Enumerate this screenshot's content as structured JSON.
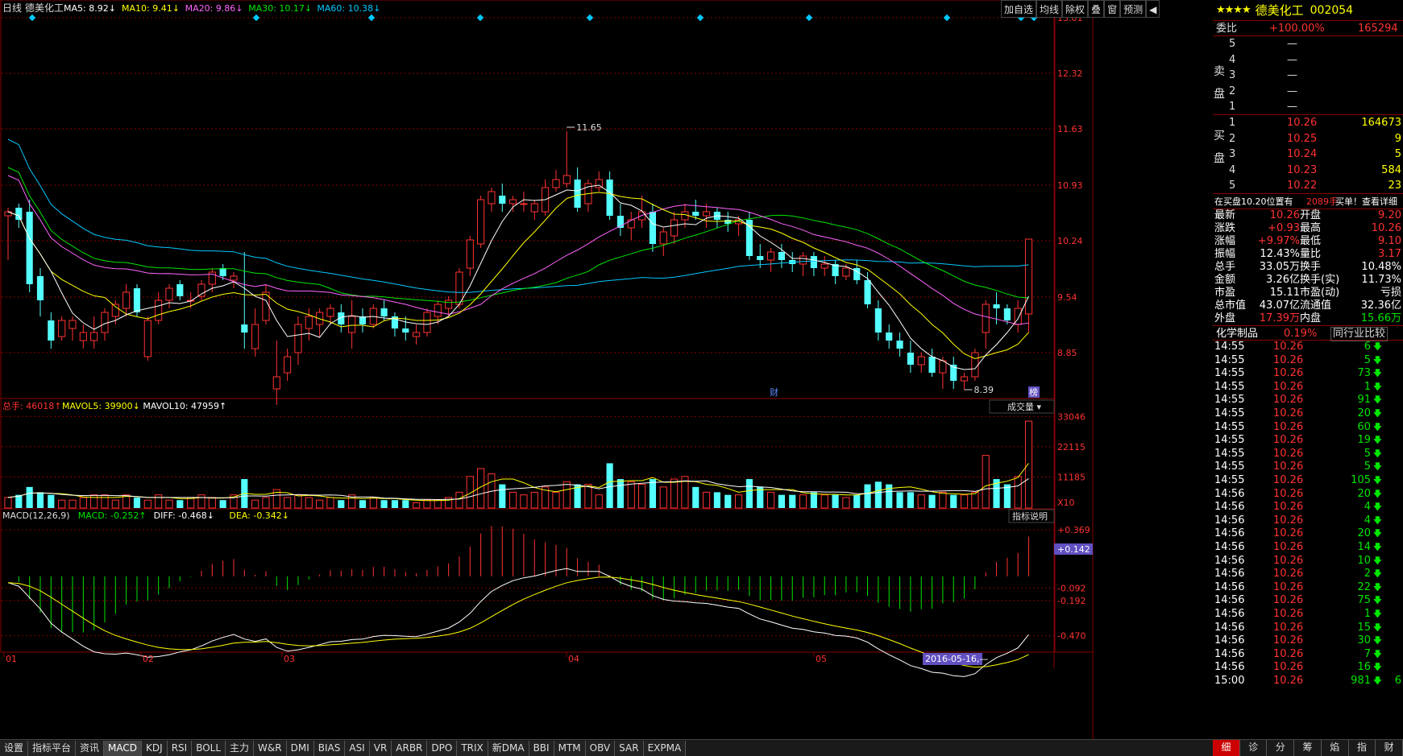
{
  "header": {
    "period": "日线",
    "stock": "德美化工",
    "ma": [
      {
        "label": "MA5: 8.92",
        "arrow": "↓",
        "color": "#ffffff"
      },
      {
        "label": "MA10: 9.41",
        "arrow": "↓",
        "color": "#ffff00"
      },
      {
        "label": "MA20: 9.86",
        "arrow": "↓",
        "color": "#ff64ff"
      },
      {
        "label": "MA30: 10.17",
        "arrow": "↓",
        "color": "#00e600"
      },
      {
        "label": "MA60: 10.38",
        "arrow": "↓",
        "color": "#00c8ff"
      }
    ]
  },
  "toolbar": [
    "加自选",
    "均线",
    "除权",
    "叠",
    "窗",
    "预测"
  ],
  "price_axis": [
    "13.01",
    "12.32",
    "11.63",
    "10.93",
    "10.24",
    "9.54",
    "8.85"
  ],
  "annotations": {
    "high": "11.65",
    "low": "8.39",
    "cai": "财",
    "bang": "榜"
  },
  "vol_header": [
    {
      "label": "总手: 46018",
      "arrow": "↑",
      "color": "#ff3232"
    },
    {
      "label": "MAVOL5: 39900",
      "arrow": "↓",
      "color": "#ffff00"
    },
    {
      "label": "MAVOL10: 47959",
      "arrow": "↑",
      "color": "#ffffff"
    }
  ],
  "vol_selector": "成交量",
  "vol_axis": [
    "33046",
    "22115",
    "11185"
  ],
  "vol_unit": "X10",
  "macd_header": [
    {
      "label": "MACD(12,26,9)",
      "arrow": "",
      "color": "#dddddd"
    },
    {
      "label": "MACD: -0.252",
      "arrow": "↑",
      "color": "#00e600"
    },
    {
      "label": "DIFF: -0.468",
      "arrow": "↓",
      "color": "#ffffff"
    },
    {
      "label": "DEA: -0.342",
      "arrow": "↓",
      "color": "#ffff00"
    }
  ],
  "macd_btn": "指标说明",
  "macd_axis": [
    "0.369",
    "-0.092",
    "-0.192",
    "-0.470"
  ],
  "macd_cursor": "+0.142",
  "date_axis": [
    "01",
    "02",
    "03",
    "04",
    "05"
  ],
  "date_cursor": "2016-05-16,—",
  "bottom_tabs": [
    "设置",
    "指标平台",
    "资讯",
    "MACD",
    "KDJ",
    "RSI",
    "BOLL",
    "主力",
    "W&R",
    "DMI",
    "BIAS",
    "ASI",
    "VR",
    "ARBR",
    "DPO",
    "TRIX",
    "新DMA",
    "BBI",
    "MTM",
    "OBV",
    "SAR",
    "EXPMA"
  ],
  "active_tab": "MACD",
  "quote": {
    "stars": "★★★★",
    "name": "德美化工",
    "code": "002054",
    "weibi_label": "委比",
    "weibi_value": "+100.00%",
    "weibi_diff": "165294",
    "sell_label": [
      "卖",
      "盘"
    ],
    "buy_label": [
      "买",
      "盘"
    ],
    "sells": [
      {
        "n": "5",
        "p": "—",
        "v": ""
      },
      {
        "n": "4",
        "p": "—",
        "v": ""
      },
      {
        "n": "3",
        "p": "—",
        "v": ""
      },
      {
        "n": "2",
        "p": "—",
        "v": ""
      },
      {
        "n": "1",
        "p": "—",
        "v": ""
      }
    ],
    "buys": [
      {
        "n": "1",
        "p": "10.26",
        "v": "164673"
      },
      {
        "n": "2",
        "p": "10.25",
        "v": "9"
      },
      {
        "n": "3",
        "p": "10.24",
        "v": "5"
      },
      {
        "n": "4",
        "p": "10.23",
        "v": "584"
      },
      {
        "n": "5",
        "p": "10.22",
        "v": "23"
      }
    ],
    "notice": {
      "a": "在买盘10.20位置有",
      "b": "2089手",
      "c": "买单！查看详细"
    },
    "stats": [
      [
        "最新",
        "10.26",
        "red",
        "开盘",
        "9.20",
        "red"
      ],
      [
        "涨跌",
        "+0.93",
        "red",
        "最高",
        "10.26",
        "red"
      ],
      [
        "涨幅",
        "+9.97%",
        "red",
        "最低",
        "9.10",
        "red"
      ],
      [
        "振幅",
        "12.43%",
        "white",
        "量比",
        "3.17",
        "red"
      ],
      [
        "总手",
        "33.05万",
        "white",
        "换手",
        "10.48%",
        "white"
      ],
      [
        "金额",
        "3.26亿",
        "white",
        "换手(实)",
        "11.73%",
        "white"
      ],
      [
        "市盈",
        "15.11",
        "white",
        "市盈(动)",
        "亏损",
        "white"
      ],
      [
        "总市值",
        "43.07亿",
        "white",
        "流通值",
        "32.36亿",
        "white"
      ],
      [
        "外盘",
        "17.39万",
        "red",
        "内盘",
        "15.66万",
        "green"
      ]
    ],
    "sector": "化学制品",
    "sector_pct": "0.19%",
    "sector_btn": "同行业比较",
    "ticks": [
      [
        "14:55",
        "10.26",
        "6"
      ],
      [
        "14:55",
        "10.26",
        "5"
      ],
      [
        "14:55",
        "10.26",
        "73"
      ],
      [
        "14:55",
        "10.26",
        "1"
      ],
      [
        "14:55",
        "10.26",
        "91"
      ],
      [
        "14:55",
        "10.26",
        "20"
      ],
      [
        "14:55",
        "10.26",
        "60"
      ],
      [
        "14:55",
        "10.26",
        "19"
      ],
      [
        "14:55",
        "10.26",
        "5"
      ],
      [
        "14:55",
        "10.26",
        "5"
      ],
      [
        "14:55",
        "10.26",
        "105"
      ],
      [
        "14:56",
        "10.26",
        "20"
      ],
      [
        "14:56",
        "10.26",
        "4"
      ],
      [
        "14:56",
        "10.26",
        "4"
      ],
      [
        "14:56",
        "10.26",
        "20"
      ],
      [
        "14:56",
        "10.26",
        "14"
      ],
      [
        "14:56",
        "10.26",
        "10"
      ],
      [
        "14:56",
        "10.26",
        "2"
      ],
      [
        "14:56",
        "10.26",
        "22"
      ],
      [
        "14:56",
        "10.26",
        "75"
      ],
      [
        "14:56",
        "10.26",
        "1"
      ],
      [
        "14:56",
        "10.26",
        "15"
      ],
      [
        "14:56",
        "10.26",
        "30"
      ],
      [
        "14:56",
        "10.26",
        "7"
      ],
      [
        "14:56",
        "10.26",
        "16"
      ],
      [
        "15:00",
        "10.26",
        "981"
      ]
    ],
    "tick_tail": "6",
    "tabs": [
      "细",
      "诊",
      "分",
      "筹",
      "焰",
      "指",
      "财"
    ],
    "active": "细"
  },
  "chart_data": {
    "type": "candlestick",
    "price_range": [
      8.39,
      13.01
    ],
    "candles": [
      [
        10.55,
        10.65,
        10.0,
        10.6,
        4
      ],
      [
        10.65,
        10.7,
        10.4,
        10.5,
        5
      ],
      [
        10.6,
        10.75,
        9.6,
        9.7,
        8
      ],
      [
        9.8,
        9.9,
        9.3,
        9.5,
        6
      ],
      [
        9.25,
        9.35,
        8.9,
        9.0,
        5
      ],
      [
        9.05,
        9.3,
        9.0,
        9.25,
        3
      ],
      [
        9.15,
        9.3,
        9.0,
        9.25,
        3
      ],
      [
        9.0,
        9.2,
        8.9,
        9.1,
        4
      ],
      [
        9.0,
        9.3,
        8.9,
        9.1,
        5
      ],
      [
        9.1,
        9.4,
        9.0,
        9.35,
        5
      ],
      [
        9.3,
        9.5,
        9.2,
        9.45,
        3
      ],
      [
        9.4,
        9.7,
        9.3,
        9.6,
        5
      ],
      [
        9.65,
        9.7,
        9.3,
        9.35,
        4
      ],
      [
        8.8,
        9.3,
        8.75,
        9.25,
        3
      ],
      [
        9.25,
        9.6,
        9.2,
        9.5,
        5
      ],
      [
        9.5,
        9.7,
        9.4,
        9.65,
        3
      ],
      [
        9.7,
        9.75,
        9.5,
        9.55,
        3
      ],
      [
        9.5,
        9.6,
        9.4,
        9.5,
        4
      ],
      [
        9.55,
        9.75,
        9.5,
        9.7,
        5
      ],
      [
        9.7,
        9.9,
        9.6,
        9.85,
        4
      ],
      [
        9.9,
        9.95,
        9.75,
        9.8,
        3
      ],
      [
        9.75,
        9.85,
        9.65,
        9.8,
        5
      ],
      [
        9.2,
        10.1,
        8.9,
        9.1,
        11
      ],
      [
        8.9,
        9.4,
        8.8,
        9.2,
        3
      ],
      [
        9.25,
        9.7,
        9.2,
        9.6,
        4
      ],
      [
        8.4,
        9.0,
        8.2,
        8.55,
        7
      ],
      [
        8.6,
        8.9,
        8.5,
        8.8,
        4
      ],
      [
        8.85,
        9.3,
        8.7,
        9.2,
        5
      ],
      [
        9.15,
        9.4,
        9.0,
        9.3,
        4
      ],
      [
        9.2,
        9.4,
        9.05,
        9.35,
        3
      ],
      [
        9.3,
        9.45,
        9.2,
        9.4,
        4
      ],
      [
        9.35,
        9.45,
        9.1,
        9.2,
        3
      ],
      [
        9.1,
        9.5,
        8.9,
        9.3,
        5
      ],
      [
        9.3,
        9.4,
        9.1,
        9.2,
        3
      ],
      [
        9.2,
        9.45,
        9.15,
        9.4,
        4
      ],
      [
        9.4,
        9.5,
        9.25,
        9.3,
        3
      ],
      [
        9.3,
        9.35,
        9.05,
        9.15,
        3
      ],
      [
        9.15,
        9.3,
        9.0,
        9.1,
        3
      ],
      [
        9.05,
        9.2,
        8.95,
        9.1,
        2
      ],
      [
        9.1,
        9.4,
        9.05,
        9.35,
        3
      ],
      [
        9.3,
        9.5,
        9.2,
        9.45,
        3
      ],
      [
        9.4,
        9.55,
        9.3,
        9.5,
        4
      ],
      [
        9.45,
        9.9,
        9.4,
        9.85,
        6
      ],
      [
        9.9,
        10.3,
        9.8,
        10.25,
        12
      ],
      [
        10.2,
        10.8,
        10.15,
        10.75,
        15
      ],
      [
        10.7,
        10.9,
        10.6,
        10.85,
        13
      ],
      [
        10.8,
        10.95,
        10.6,
        10.7,
        9
      ],
      [
        10.7,
        10.8,
        10.6,
        10.75,
        6
      ],
      [
        10.7,
        10.85,
        10.6,
        10.7,
        5
      ],
      [
        10.6,
        10.75,
        10.5,
        10.7,
        6
      ],
      [
        10.6,
        11.0,
        10.55,
        10.9,
        8
      ],
      [
        10.9,
        11.12,
        10.85,
        11.0,
        6
      ],
      [
        10.95,
        11.6,
        10.9,
        11.05,
        10
      ],
      [
        11.0,
        11.15,
        10.6,
        10.65,
        9
      ],
      [
        10.7,
        11.0,
        10.6,
        10.95,
        9
      ],
      [
        10.9,
        11.1,
        10.85,
        11.0,
        5
      ],
      [
        11.0,
        11.1,
        10.5,
        10.55,
        17
      ],
      [
        10.55,
        10.7,
        10.3,
        10.4,
        11
      ],
      [
        10.4,
        10.6,
        10.25,
        10.5,
        10
      ],
      [
        10.5,
        10.8,
        10.4,
        10.6,
        9
      ],
      [
        10.6,
        10.7,
        10.1,
        10.2,
        11
      ],
      [
        10.2,
        10.4,
        10.05,
        10.35,
        8
      ],
      [
        10.3,
        10.6,
        10.2,
        10.5,
        11
      ],
      [
        10.5,
        10.7,
        10.4,
        10.6,
        12
      ],
      [
        10.6,
        10.75,
        10.5,
        10.55,
        8
      ],
      [
        10.55,
        10.7,
        10.4,
        10.6,
        6
      ],
      [
        10.6,
        10.65,
        10.4,
        10.5,
        6
      ],
      [
        10.5,
        10.6,
        10.35,
        10.45,
        5
      ],
      [
        10.45,
        10.55,
        10.3,
        10.5,
        5
      ],
      [
        10.5,
        10.6,
        10.0,
        10.05,
        11
      ],
      [
        10.05,
        10.2,
        9.9,
        10.0,
        8
      ],
      [
        10.0,
        10.15,
        9.85,
        10.1,
        6
      ],
      [
        10.1,
        10.2,
        9.9,
        10.0,
        5
      ],
      [
        10.0,
        10.1,
        9.85,
        9.95,
        5
      ],
      [
        9.95,
        10.1,
        9.8,
        10.05,
        5
      ],
      [
        10.05,
        10.1,
        9.8,
        9.9,
        6
      ],
      [
        9.9,
        10.05,
        9.8,
        9.95,
        5
      ],
      [
        9.95,
        10.0,
        9.7,
        9.8,
        5
      ],
      [
        9.8,
        9.95,
        9.75,
        9.9,
        4
      ],
      [
        9.9,
        10.0,
        9.7,
        9.75,
        5
      ],
      [
        9.75,
        9.85,
        9.4,
        9.45,
        9
      ],
      [
        9.4,
        9.5,
        9.0,
        9.1,
        10
      ],
      [
        9.1,
        9.2,
        8.9,
        9.0,
        9
      ],
      [
        9.0,
        9.1,
        8.8,
        8.9,
        6
      ],
      [
        8.85,
        9.0,
        8.6,
        8.7,
        6
      ],
      [
        8.7,
        8.85,
        8.6,
        8.8,
        5
      ],
      [
        8.8,
        8.9,
        8.55,
        8.6,
        5
      ],
      [
        8.6,
        8.8,
        8.4,
        8.75,
        6
      ],
      [
        8.7,
        8.8,
        8.4,
        8.5,
        5
      ],
      [
        8.5,
        8.6,
        8.39,
        8.55,
        5
      ],
      [
        8.55,
        8.9,
        8.5,
        8.85,
        6
      ],
      [
        9.1,
        9.5,
        8.9,
        9.45,
        20
      ],
      [
        9.45,
        9.6,
        9.2,
        9.4,
        11
      ],
      [
        9.4,
        9.45,
        9.2,
        9.25,
        9
      ],
      [
        9.2,
        9.5,
        9.1,
        9.4,
        12
      ],
      [
        9.33,
        10.26,
        9.1,
        10.26,
        33
      ]
    ]
  }
}
